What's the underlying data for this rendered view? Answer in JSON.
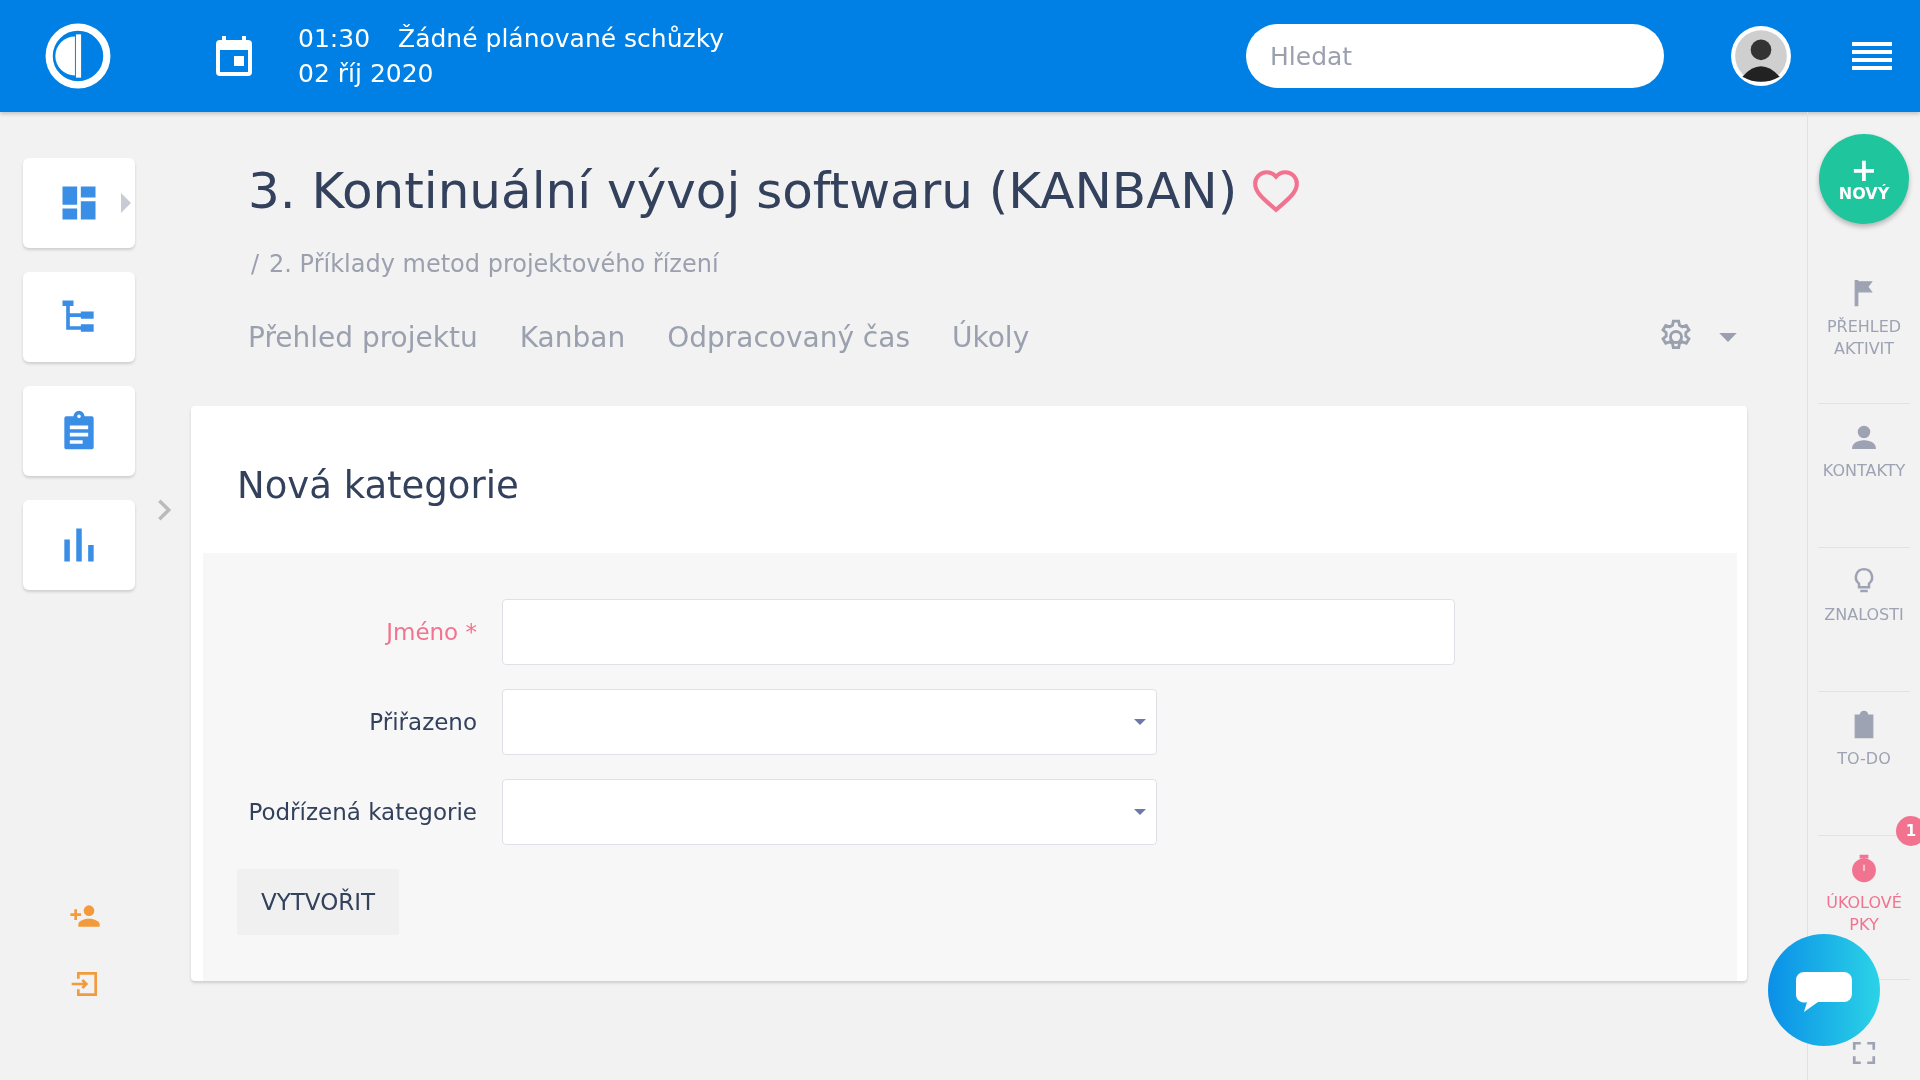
{
  "topbar": {
    "time": "01:30",
    "meetings": "Žádné plánované schůzky",
    "date": "02 říj 2020",
    "search": {
      "placeholder": "Hledat"
    }
  },
  "left_sidebar": {
    "items": [
      {
        "kind": "dashboard",
        "expandable": true
      },
      {
        "kind": "tree",
        "expandable": false
      },
      {
        "kind": "clipboard",
        "expandable": false
      },
      {
        "kind": "chart",
        "expandable": false
      }
    ],
    "bottom_items": [
      {
        "kind": "add-user"
      },
      {
        "kind": "login"
      }
    ]
  },
  "page": {
    "title": "3. Kontinuální vývoj softwaru (KANBAN)",
    "favorite": false,
    "breadcrumb_separator": "/",
    "breadcrumb": "2. Příklady metod projektového řízení",
    "tabs": [
      {
        "label": "Přehled projektu",
        "selected": false
      },
      {
        "label": "Kanban",
        "selected": false
      },
      {
        "label": "Odpracovaný čas",
        "selected": false
      },
      {
        "label": "Úkoly",
        "selected": false
      }
    ]
  },
  "form": {
    "title": "Nová kategorie",
    "fields": [
      {
        "label": "Jméno *",
        "kind": "text",
        "required": true
      },
      {
        "label": "Přiřazeno",
        "kind": "select",
        "required": false
      },
      {
        "label": "Podřízená kategorie",
        "kind": "select",
        "required": false
      }
    ],
    "submit": "VYTVOŘIT"
  },
  "right_sidebar": {
    "new_button": {
      "icon": "+",
      "label": "NOVÝ"
    },
    "items": [
      {
        "kind": "flag",
        "lines": [
          "PŘEHLED",
          "AKTIVIT"
        ],
        "highlighted": false
      },
      {
        "kind": "person",
        "lines": [
          "KONTAKTY"
        ],
        "highlighted": false
      },
      {
        "kind": "bulb",
        "lines": [
          "ZNALOSTI"
        ],
        "highlighted": false
      },
      {
        "kind": "todo",
        "lines": [
          "TO-DO"
        ],
        "highlighted": false
      },
      {
        "kind": "timer",
        "lines": [
          "ÚKOLOVÉ",
          "PKY"
        ],
        "highlighted": true,
        "badge": "1"
      }
    ]
  }
}
